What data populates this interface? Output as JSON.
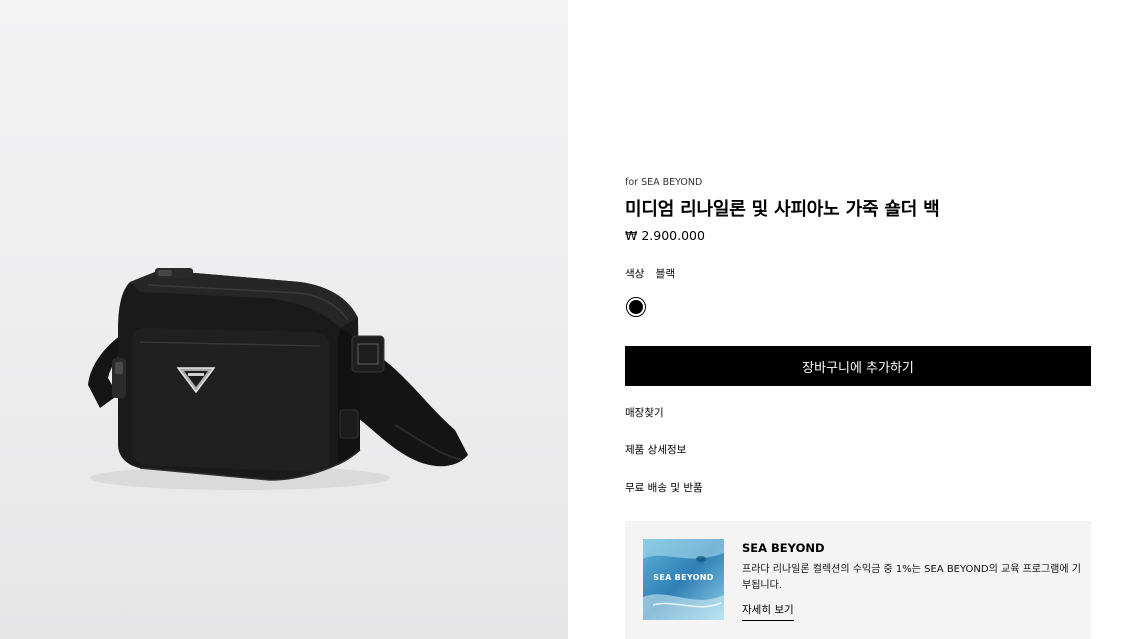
{
  "product": {
    "collection": "for SEA BEYOND",
    "title": "미디엄 리나일론 및 사피아노 가죽 숄더 백",
    "price": "₩ 2.900.000",
    "image_alt": "블랙 나일론 숄더 백"
  },
  "color": {
    "label": "색상",
    "value": "블랙",
    "swatches": [
      {
        "name": "블랙",
        "hex": "#000000",
        "selected": true
      }
    ]
  },
  "actions": {
    "add_to_cart": "장바구니에 추가하기"
  },
  "links": {
    "store_finder": "매장찾기",
    "details": "제품 상세정보",
    "shipping": "무료 배송 및 반품"
  },
  "sea_beyond": {
    "heading": "SEA BEYOND",
    "thumbnail_text": "SEA BEYOND",
    "description": "프라다 리나일론 컬렉션의 수익금 중 1%는 SEA BEYOND의 교육 프로그램에 기부됩니다.",
    "more_link": "자세히 보기"
  },
  "colors": {
    "button_bg": "#000000",
    "card_bg": "#f4f4f4",
    "image_bg": "#ededee"
  }
}
